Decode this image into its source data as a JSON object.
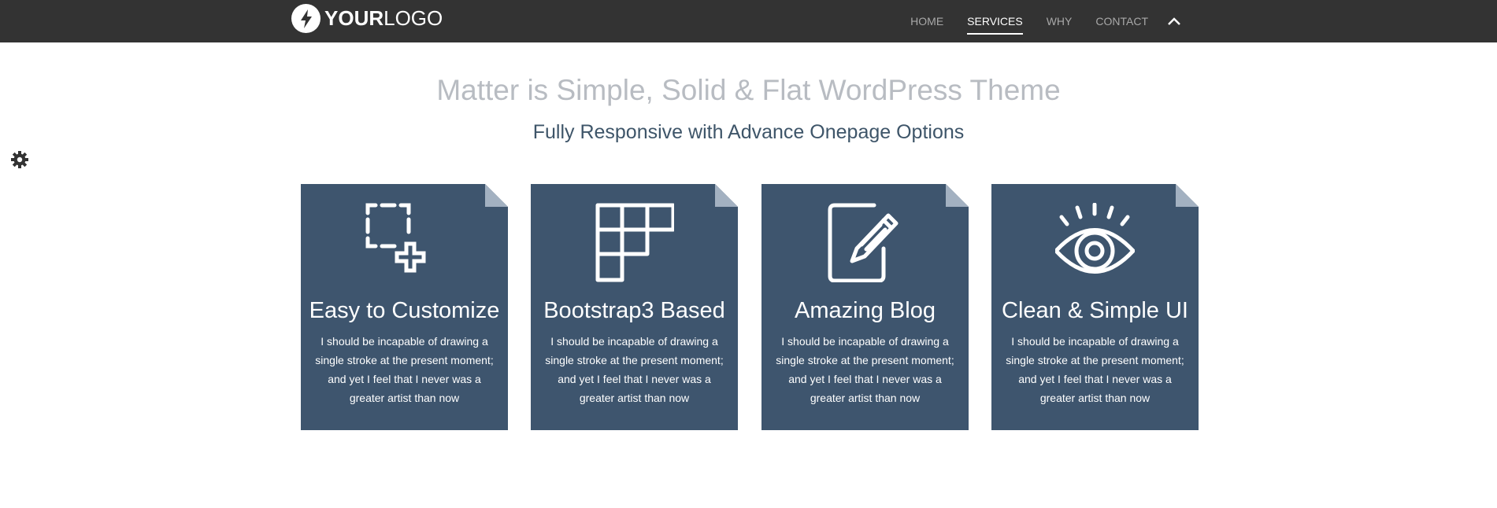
{
  "header": {
    "logo": {
      "bold": "YOUR",
      "light": "LOGO",
      "icon": "lightning-bolt-icon"
    },
    "nav": [
      {
        "label": "HOME",
        "active": false
      },
      {
        "label": "SERVICES",
        "active": true
      },
      {
        "label": "WHY",
        "active": false
      },
      {
        "label": "CONTACT",
        "active": false
      }
    ],
    "scroll_top_icon": "chevron-up-icon"
  },
  "settings_icon": "gear-icon",
  "hero": {
    "title": "Matter is Simple, Solid & Flat WordPress Theme",
    "subtitle": "Fully Responsive with Advance Onepage Options"
  },
  "features": [
    {
      "icon": "select-add-icon",
      "title": "Easy to Customize",
      "text": "I should be incapable of drawing a single stroke at the present moment; and yet I feel that I never was a greater artist than now"
    },
    {
      "icon": "grid-icon",
      "title": "Bootstrap3 Based",
      "text": "I should be incapable of drawing a single stroke at the present moment; and yet I feel that I never was a greater artist than now"
    },
    {
      "icon": "edit-document-icon",
      "title": "Amazing Blog",
      "text": "I should be incapable of drawing a single stroke at the present moment; and yet I feel that I never was a greater artist than now"
    },
    {
      "icon": "eye-icon",
      "title": "Clean & Simple UI",
      "text": "I should be incapable of drawing a single stroke at the present moment; and yet I feel that I never was a greater artist than now"
    }
  ],
  "colors": {
    "navbar": "#333333",
    "card": "#3e556e",
    "card_fold": "#a3b1c1",
    "hero_title": "#b8bcc2",
    "hero_subtitle": "#3e5569"
  }
}
